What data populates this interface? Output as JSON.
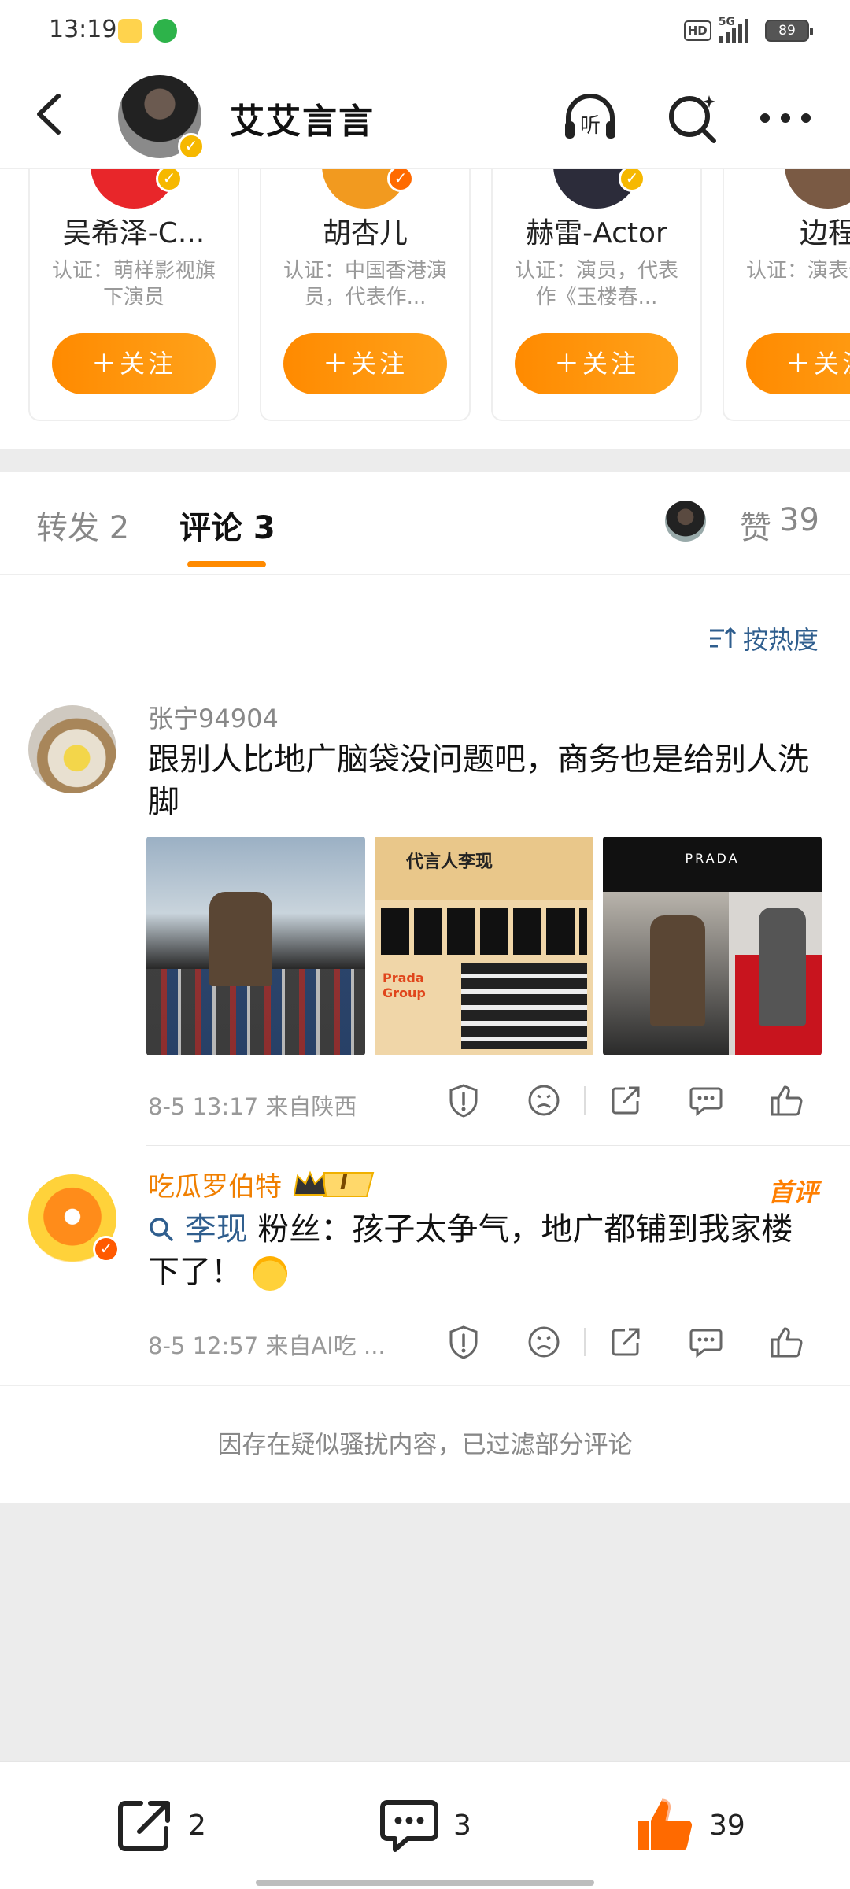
{
  "status_bar": {
    "time": "13:19",
    "hd": "HD",
    "network": "5G",
    "battery": "89"
  },
  "header": {
    "title": "艾艾言言"
  },
  "recommendations": [
    {
      "name": "吴希泽-C...",
      "desc": "认证：萌样影视旗下演员",
      "follow_label": "＋关注"
    },
    {
      "name": "胡杏儿",
      "desc": "认证：中国香港演员，代表作...",
      "follow_label": "＋关注"
    },
    {
      "name": "赫雷-Actor",
      "desc": "认证：演员，代表作《玉楼春...",
      "follow_label": "＋关注"
    },
    {
      "name": "边程",
      "desc": "认证：演表作品《",
      "follow_label": "＋关注"
    }
  ],
  "tabs": {
    "repost": "转发 2",
    "comments": "评论 3",
    "likes_label": "赞",
    "likes_count": "39"
  },
  "sort": {
    "label": "按热度"
  },
  "comments": [
    {
      "user": "张宁94904",
      "text": "跟别人比地广脑袋没问题吧，商务也是给别人洗脚",
      "meta": "8-5 13:17  来自陕西",
      "images": [
        {
          "caption": ""
        },
        {
          "caption": "代言人李现"
        },
        {
          "caption": "PRADA"
        }
      ]
    },
    {
      "user": "吃瓜罗伯特",
      "badge": "I",
      "tag": "首评",
      "mention": "李现",
      "text": " 粉丝：孩子太争气，地广都铺到我家楼下了！",
      "meta": "8-5 12:57  来自AI吃 ..."
    }
  ],
  "filter_note": "因存在疑似骚扰内容，已过滤部分评论",
  "bottom_bar": {
    "repost_count": "2",
    "comment_count": "3",
    "like_count": "39"
  },
  "colors": {
    "accent": "#ff8a00",
    "link": "#2f5e8e",
    "like": "#ff6a00"
  }
}
